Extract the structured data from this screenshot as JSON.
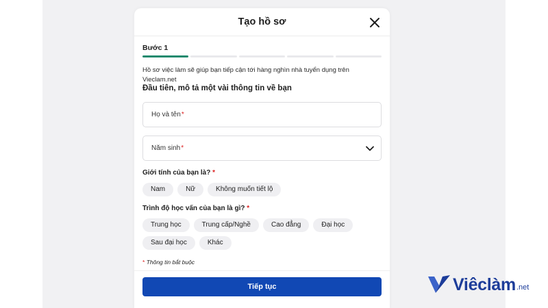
{
  "modal": {
    "title": "Tạo hồ sơ",
    "step_label": "Bước 1",
    "progress": {
      "current_step": 1,
      "total_steps": 5
    },
    "intro": "Hồ sơ việc làm sẽ giúp bạn tiếp cận tới hàng nghìn nhà tuyển dụng trên Vieclam.net",
    "section_title": "Đầu tiên, mô tả một vài thông tin về bạn",
    "fields": {
      "full_name": {
        "placeholder": "Họ và tên",
        "required_mark": "*"
      },
      "birth_year": {
        "placeholder": "Năm sinh",
        "required_mark": "*"
      }
    },
    "gender": {
      "label": "Giới tính của bạn là?",
      "required_mark": "*",
      "options": [
        "Nam",
        "Nữ",
        "Không muốn tiết lộ"
      ]
    },
    "education": {
      "label": "Trình độ học vấn của bạn là gì?",
      "required_mark": "*",
      "options_row1": [
        "Trung học",
        "Trung cấp/Nghề",
        "Cao đẳng",
        "Đại học"
      ],
      "options_row2": [
        "Sau đại học",
        "Khác"
      ]
    },
    "note": {
      "mark": "*",
      "text": "Thông tin bắt buộc"
    },
    "continue_label": "Tiếp tục"
  },
  "brand": {
    "name": "Viêclàm",
    "suffix": ".net",
    "color": "#1d3d9a"
  },
  "icons": {
    "close": "close-icon",
    "chevron": "chevron-down-icon",
    "logo": "logo-icon"
  },
  "colors": {
    "primary": "#1148b4",
    "progress_active": "#1a8a6e",
    "required": "#dd2222"
  }
}
